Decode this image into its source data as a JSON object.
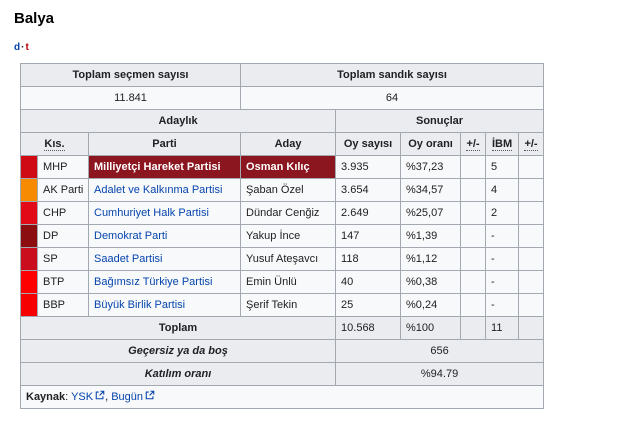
{
  "page": {
    "title": "Balya"
  },
  "template_links": {
    "d": "d",
    "separator": "·",
    "t": "t"
  },
  "colors": {
    "winner_bg": "#8c1620",
    "link_blue": "#0645ad",
    "redlink": "#ba0000",
    "header_bg": "#eaecf0",
    "cell_bg": "#f8f9fa",
    "border": "#a2a9b1"
  },
  "table": {
    "top_headers": [
      {
        "label": "Toplam seçmen sayısı",
        "value": "11.841"
      },
      {
        "label": "Toplam sandık sayısı",
        "value": "64"
      }
    ],
    "group_headers": {
      "candidacy": "Adaylık",
      "results": "Sonuçlar"
    },
    "columns": {
      "abbr": "Kıs.",
      "party": "Parti",
      "candidate": "Aday",
      "votes": "Oy sayısı",
      "share": "Oy oranı",
      "change1": "+/-",
      "seats": "İBM",
      "change2": "+/-"
    },
    "rows": [
      {
        "abbr": "MHP",
        "party": "Milliyetçi Hareket Partisi",
        "candidate": "Osman Kılıç",
        "votes": "3.935",
        "share": "%37,23",
        "change1": "",
        "seats": "5",
        "change2": "",
        "color": "#cf0a15",
        "winner": true
      },
      {
        "abbr": "AK Parti",
        "party": "Adalet ve Kalkınma Partisi",
        "candidate": "Şaban Özel",
        "votes": "3.654",
        "share": "%34,57",
        "change1": "",
        "seats": "4",
        "change2": "",
        "color": "#f68a00",
        "winner": false
      },
      {
        "abbr": "CHP",
        "party": "Cumhuriyet Halk Partisi",
        "candidate": "Dündar Cenğiz",
        "votes": "2.649",
        "share": "%25,07",
        "change1": "",
        "seats": "2",
        "change2": "",
        "color": "#e30a17",
        "winner": false
      },
      {
        "abbr": "DP",
        "party": "Demokrat Parti",
        "candidate": "Yakup İnce",
        "votes": "147",
        "share": "%1,39",
        "change1": "",
        "seats": "-",
        "change2": "",
        "color": "#8b0d10",
        "winner": false
      },
      {
        "abbr": "SP",
        "party": "Saadet Partisi",
        "candidate": "Yusuf Ateşavcı",
        "votes": "118",
        "share": "%1,12",
        "change1": "",
        "seats": "-",
        "change2": "",
        "color": "#cb0e1e",
        "winner": false
      },
      {
        "abbr": "BTP",
        "party": "Bağımsız Türkiye Partisi",
        "candidate": "Emin Ünlü",
        "votes": "40",
        "share": "%0,38",
        "change1": "",
        "seats": "-",
        "change2": "",
        "color": "#fe0000",
        "winner": false
      },
      {
        "abbr": "BBP",
        "party": "Büyük Birlik Partisi",
        "candidate": "Şerif Tekin",
        "votes": "25",
        "share": "%0,24",
        "change1": "",
        "seats": "-",
        "change2": "",
        "color": "#f70000",
        "winner": false
      }
    ],
    "total_row": {
      "label": "Toplam",
      "votes": "10.568",
      "share": "%100",
      "change1": "",
      "seats": "11",
      "change2": ""
    },
    "invalid_row": {
      "label": "Geçersiz ya da boş",
      "value": "656"
    },
    "turnout_row": {
      "label": "Katılım oranı",
      "value": "%94.79"
    },
    "source_row": {
      "label": "Kaynak",
      "colon": ": ",
      "link1": "YSK",
      "comma": ", ",
      "link2": "Bugün"
    }
  }
}
